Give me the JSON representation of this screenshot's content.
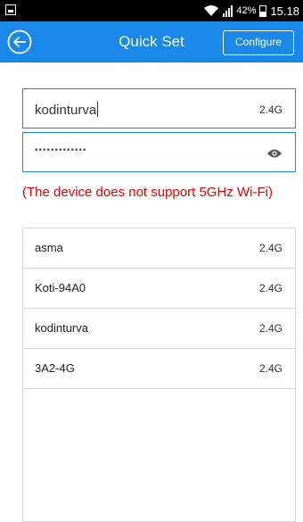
{
  "status_bar": {
    "battery_percent": "42%",
    "time": "15.18"
  },
  "app_bar": {
    "title": "Quick Set",
    "configure_label": "Configure",
    "back_icon": "back-circle-arrow-icon"
  },
  "form": {
    "ssid_value": "kodinturva",
    "ssid_band": "2.4G",
    "password_mask": "•••••••••••••",
    "password_icon": "eye-icon"
  },
  "warning_text": "(The device does not support 5GHz Wi-Fi)",
  "networks": [
    {
      "name": "asma",
      "band": "2.4G"
    },
    {
      "name": "Koti-94A0",
      "band": "2.4G"
    },
    {
      "name": "kodinturva",
      "band": "2.4G"
    },
    {
      "name": "3A2-4G",
      "band": "2.4G"
    }
  ],
  "colors": {
    "accent": "#1a88e9",
    "warning": "#e60000"
  }
}
